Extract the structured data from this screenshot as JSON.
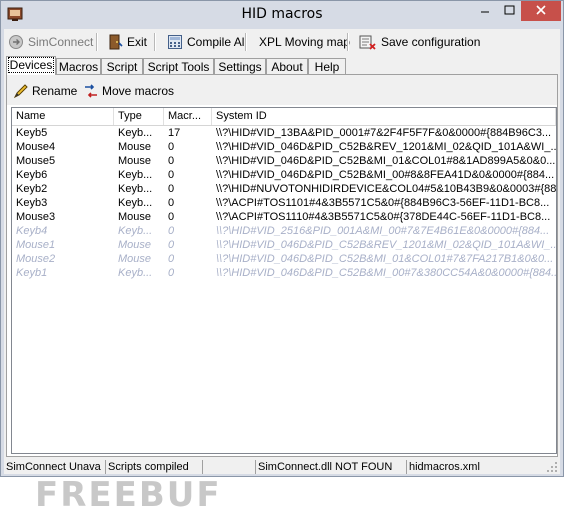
{
  "window": {
    "title": "HID macros"
  },
  "toolbar": {
    "simconnect": {
      "label": "SimConnect",
      "icon": "simconnect-icon"
    },
    "exit": {
      "label": "Exit",
      "icon": "exit-door-icon"
    },
    "compile_all": {
      "label": "Compile All",
      "icon": "calculator-icon"
    },
    "xpl_moving_map": {
      "label": "XPL Moving map"
    },
    "save_configuration": {
      "label": "Save configuration",
      "icon": "save-config-icon"
    }
  },
  "tabs": [
    {
      "label": "Devices",
      "active": true
    },
    {
      "label": "Macros"
    },
    {
      "label": "Script"
    },
    {
      "label": "Script Tools"
    },
    {
      "label": "Settings"
    },
    {
      "label": "About"
    },
    {
      "label": "Help"
    }
  ],
  "devices": {
    "rename": {
      "label": "Rename",
      "icon": "pencil-icon"
    },
    "move_macros": {
      "label": "Move macros",
      "icon": "move-arrows-icon"
    },
    "columns": {
      "name": "Name",
      "type": "Type",
      "macros": "Macr...",
      "system_id": "System ID"
    },
    "rows": [
      {
        "name": "Keyb5",
        "type": "Keyb...",
        "macros": "17",
        "system_id": "\\\\?\\HID#VID_13BA&PID_0001#7&2F4F5F7F&0&0000#{884B96C3...",
        "active": true
      },
      {
        "name": "Mouse4",
        "type": "Mouse",
        "macros": "0",
        "system_id": "\\\\?\\HID#VID_046D&PID_C52B&REV_1201&MI_02&QID_101A&WI_...",
        "active": true
      },
      {
        "name": "Mouse5",
        "type": "Mouse",
        "macros": "0",
        "system_id": "\\\\?\\HID#VID_046D&PID_C52B&MI_01&COL01#8&1AD899A5&0&0...",
        "active": true
      },
      {
        "name": "Keyb6",
        "type": "Keyb...",
        "macros": "0",
        "system_id": "\\\\?\\HID#VID_046D&PID_C52B&MI_00#8&8FEA41D&0&0000#{884...",
        "active": true
      },
      {
        "name": "Keyb2",
        "type": "Keyb...",
        "macros": "0",
        "system_id": "\\\\?\\HID#NUVOTONHIDIRDEVICE&COL04#5&10B43B9&0&0003#{88...",
        "active": true
      },
      {
        "name": "Keyb3",
        "type": "Keyb...",
        "macros": "0",
        "system_id": "\\\\?\\ACPI#TOS1101#4&3B5571C5&0#{884B96C3-56EF-11D1-BC8...",
        "active": true
      },
      {
        "name": "Mouse3",
        "type": "Mouse",
        "macros": "0",
        "system_id": "\\\\?\\ACPI#TOS1110#4&3B5571C5&0#{378DE44C-56EF-11D1-BC8...",
        "active": true
      },
      {
        "name": "Keyb4",
        "type": "Keyb...",
        "macros": "0",
        "system_id": "\\\\?\\HID#VID_2516&PID_001A&MI_00#7&7E4B61E&0&0000#{884...",
        "active": false
      },
      {
        "name": "Mouse1",
        "type": "Mouse",
        "macros": "0",
        "system_id": "\\\\?\\HID#VID_046D&PID_C52B&REV_1201&MI_02&QID_101A&WI_...",
        "active": false
      },
      {
        "name": "Mouse2",
        "type": "Mouse",
        "macros": "0",
        "system_id": "\\\\?\\HID#VID_046D&PID_C52B&MI_01&COL01#7&7FA217B1&0&0...",
        "active": false
      },
      {
        "name": "Keyb1",
        "type": "Keyb...",
        "macros": "0",
        "system_id": "\\\\?\\HID#VID_046D&PID_C52B&MI_00#7&380CC54A&0&0000#{884...",
        "active": false
      }
    ]
  },
  "watermark": "FREEBUF",
  "statusbar": [
    "SimConnect Unava",
    "Scripts compiled",
    "",
    "SimConnect.dll NOT FOUN",
    "hidmacros.xml"
  ],
  "colors": {
    "inactive_row_text": "#a8b0c8",
    "close_button": "#c7504a"
  }
}
